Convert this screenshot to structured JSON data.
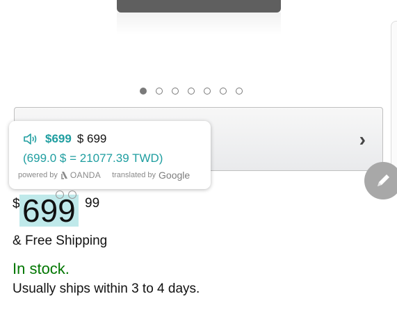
{
  "carousel": {
    "count": 7,
    "active_index": 0
  },
  "popup": {
    "price_converted": "$699",
    "price_original": "$ 699",
    "conversion": "(699.0 $ = 21077.39 TWD)",
    "powered_by": "powered by",
    "oanda": "OANDA",
    "translated_by": "translated by",
    "google": "Google",
    "accent_color": "#1f9ea0"
  },
  "price": {
    "currency": "$",
    "whole": "699",
    "fraction": "99"
  },
  "shipping": "& Free Shipping",
  "availability": {
    "stock": "In stock.",
    "stock_color": "#007600",
    "ships": "Usually ships within 3 to 4 days."
  },
  "icons": {
    "speaker": "speaker-icon",
    "next": "chevron-right-icon",
    "edit": "pencil-icon"
  }
}
